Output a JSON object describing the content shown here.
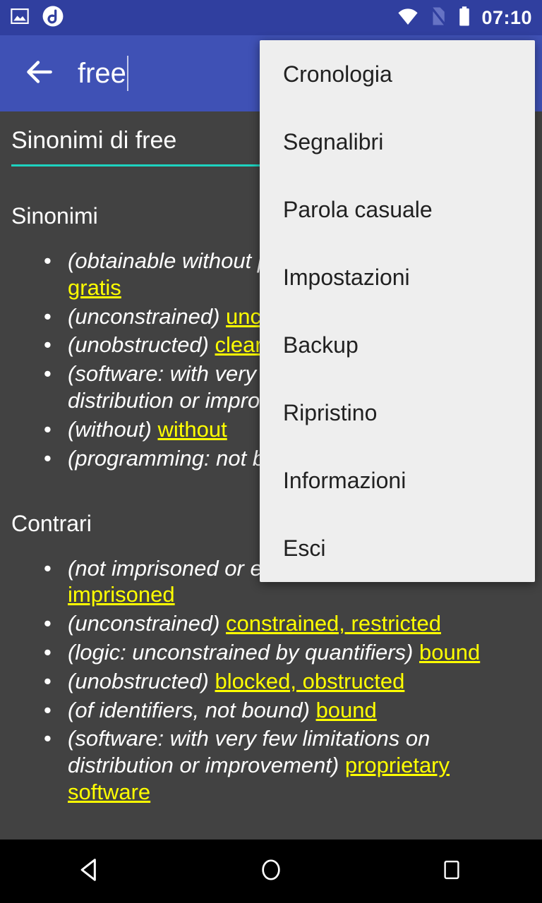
{
  "statusbar": {
    "time": "07:10",
    "left_icons": [
      "image-icon",
      "app-circle-a-icon"
    ],
    "right_icons": [
      "wifi-icon",
      "no-sim-icon",
      "battery-icon"
    ],
    "background": "#303f9f"
  },
  "appbar": {
    "back_icon": "back-arrow-icon",
    "search_value": "free",
    "search_placeholder": "free",
    "background": "#3f51b5"
  },
  "content": {
    "word_title": "Sinonimi di free",
    "divider_color": "#1dd3c0",
    "background": "#424242",
    "sections": [
      {
        "heading": "Sinonimi",
        "entries": [
          {
            "gloss": "(obtainable without payment)",
            "synonyms": "free of charge, gratis"
          },
          {
            "gloss": "(unconstrained)",
            "synonyms": "unconstrained, unhindered"
          },
          {
            "gloss": "(unobstructed)",
            "synonyms": "clear"
          },
          {
            "gloss": "(software: with very few limitations on distribution or improvement)",
            "synonyms": ""
          },
          {
            "gloss": "(without)",
            "synonyms": "without"
          },
          {
            "gloss": "(programming: not bound)",
            "synonyms": ""
          }
        ]
      },
      {
        "heading": "Contrari",
        "entries": [
          {
            "gloss": "(not imprisoned or enslaved)",
            "synonyms": "bound, enslaved, imprisoned"
          },
          {
            "gloss": "(unconstrained)",
            "synonyms": "constrained, restricted"
          },
          {
            "gloss": "(logic: unconstrained by quantifiers)",
            "synonyms": "bound"
          },
          {
            "gloss": "(unobstructed)",
            "synonyms": "blocked, obstructed"
          },
          {
            "gloss": "(of identifiers, not bound)",
            "synonyms": "bound"
          },
          {
            "gloss": "(software: with very few limitations on distribution or improvement)",
            "synonyms": "proprietary software"
          }
        ]
      }
    ],
    "synonym_color": "#ffff00"
  },
  "menu": {
    "background": "#eeeeee",
    "items": [
      {
        "label": "Cronologia"
      },
      {
        "label": "Segnalibri"
      },
      {
        "label": "Parola casuale"
      },
      {
        "label": "Impostazioni"
      },
      {
        "label": "Backup"
      },
      {
        "label": "Ripristino"
      },
      {
        "label": "Informazioni"
      },
      {
        "label": "Esci"
      }
    ]
  },
  "navbar": {
    "back_icon": "nav-back-triangle-icon",
    "home_icon": "nav-home-circle-icon",
    "recents_icon": "nav-recents-square-icon",
    "background": "#000000"
  }
}
